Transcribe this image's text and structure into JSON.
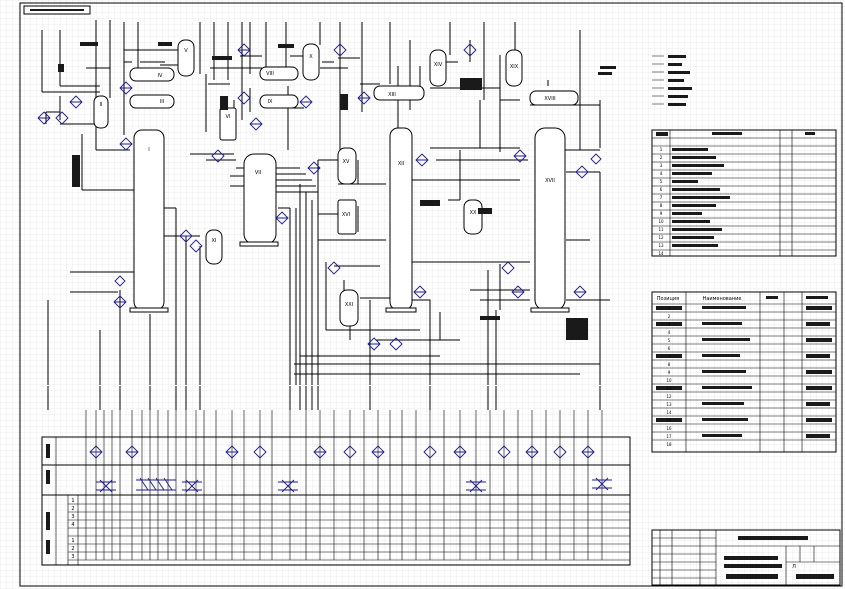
{
  "equipment_labels": [
    "I",
    "II",
    "III",
    "IV",
    "V",
    "VI",
    "VII",
    "VIII",
    "IX",
    "X",
    "XI",
    "XII",
    "XIII",
    "XIV",
    "XV",
    "XVI",
    "XVII",
    "XVIII",
    "XIX",
    "XX",
    "XXI"
  ],
  "table2": {
    "header": [
      "Позиция",
      "Наименование"
    ],
    "row_nums": [
      "1",
      "2",
      "3",
      "4",
      "5",
      "6",
      "7",
      "8",
      "9",
      "10",
      "11",
      "12",
      "13",
      "14",
      "15",
      "16",
      "17",
      "18",
      "19",
      "20"
    ]
  },
  "table1": {
    "row_nums": [
      "1",
      "2",
      "3",
      "4",
      "5",
      "6",
      "7",
      "8",
      "9",
      "10",
      "11",
      "12",
      "13",
      "14"
    ]
  },
  "bottom_rows_a": [
    "1",
    "2",
    "3",
    "4"
  ],
  "bottom_rows_b": [
    "1",
    "2",
    "3"
  ],
  "stamp": {
    "sheet_label": "Л"
  },
  "colors": {
    "grid": "#d9d9d9",
    "symbol": "#1c1c8c",
    "line": "#000000"
  }
}
